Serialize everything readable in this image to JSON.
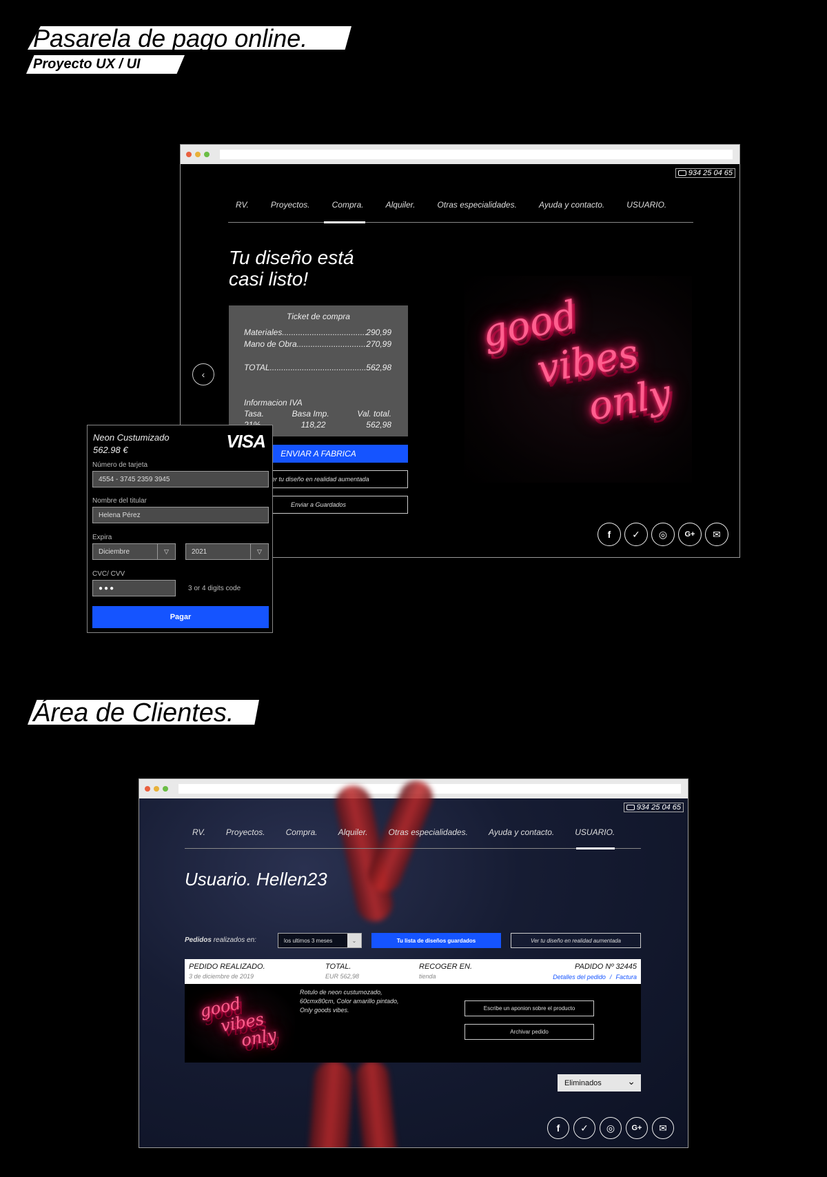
{
  "header": {
    "title": "Pasarela de pago online.",
    "subtitle": "Proyecto UX / UI"
  },
  "section2": {
    "title": "Área de Clientes."
  },
  "site": {
    "phone": "934 25 04 65",
    "nav": [
      "RV.",
      "Proyectos.",
      "Compra.",
      "Alquiler.",
      "Otras especialidades.",
      "Ayuda y contacto.",
      "USUARIO."
    ]
  },
  "checkout": {
    "active_tab": "Compra.",
    "hero_line1": "Tu diseño está",
    "hero_line2": "casi listo!",
    "ticket": {
      "title": "Ticket de compra",
      "rows": [
        {
          "label": "Materiales",
          "value": "290,99"
        },
        {
          "label": "Mano de Obra",
          "value": "270,99"
        }
      ],
      "total_label": "TOTAL",
      "total_value": "562,98",
      "iva_title": "Informacion IVA",
      "iva_headers": [
        "Tasa.",
        "Basa Imp.",
        "Val. total."
      ],
      "iva_values": [
        "21%",
        "118,22",
        "562,98"
      ]
    },
    "send_factory": "ENVIAR A FABRICA",
    "ar_button": "Ver tu diseño en realidad aumentada",
    "saved_button": "Enviar a Guardados",
    "neon_words": [
      "good",
      "vibes",
      "only"
    ]
  },
  "payment": {
    "product": "Neon Custumizado",
    "price": "562.98 €",
    "brand": "VISA",
    "card_label": "Número de tarjeta",
    "card_value": "4554 - 3745 2359 3945",
    "holder_label": "Nombre del titular",
    "holder_value": "Helena Pérez",
    "expiry_label": "Expira",
    "month": "Diciembre",
    "year": "2021",
    "cvc_label": "CVC/ CVV",
    "cvc_value": "●●●",
    "cvc_hint": "3 or 4 digits code",
    "pay_button": "Pagar"
  },
  "clients": {
    "active_tab": "USUARIO.",
    "user_title": "Usuario. Hellen23",
    "orders_label_bold": "Pedidos",
    "orders_label_rest": "realizados en:",
    "period": "los ultimos 3 meses",
    "saved_designs": "Tu lista de diseños guardados",
    "ar_button": "Ver tu diseño en realidad aumentada",
    "order": {
      "placed_label": "PEDIDO REALIZADO.",
      "placed_value": "3 de diciembre de 2019",
      "total_label": "TOTAL.",
      "total_value": "EUR 562,98",
      "pickup_label": "RECOGER EN.",
      "pickup_value": "tienda",
      "number_label": "PADIDO Nº 32445",
      "details_link": "Detalles del pedido",
      "separator": "/",
      "invoice_link": "Factura",
      "desc_line1": "Rotulo de neon custumozado,",
      "desc_line2": "60cmx80cm, Color amarillo pintado,",
      "desc_line3": "Only goods vibes.",
      "review_button": "Escribe un aponion sobre el producto",
      "archive_button": "Archivar pedido"
    },
    "filter": "Eliminados"
  },
  "colors": {
    "accent": "#1554ff",
    "neon": "#ff2a6d",
    "ticket_bg": "#555555"
  },
  "social_icons": [
    "facebook-icon",
    "twitter-icon",
    "instagram-icon",
    "google-plus-icon",
    "mail-icon"
  ],
  "social_glyphs": [
    "f",
    "✓",
    "◎",
    "G+",
    "✉"
  ]
}
